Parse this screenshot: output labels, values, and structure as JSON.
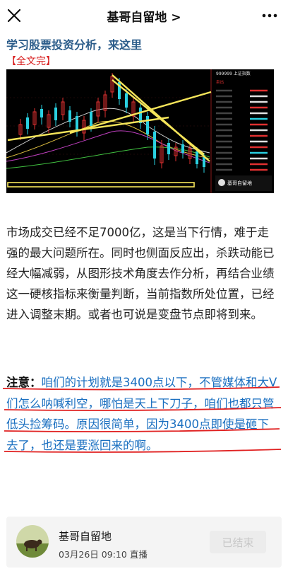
{
  "topbar": {
    "title": "基哥自留地",
    "title_chevron": ">",
    "close_icon": "close-icon",
    "more_icon": "more-icon"
  },
  "article": {
    "headline": "学习股票投资分析，来这里",
    "tag": "【全文完】",
    "paragraph": "市场成交已经不足7000亿，这是当下行情，难于走强的最大问题所在。同时也侧面反应出，杀跌动能已经大幅减弱，从图形技术角度去作分析，再结合业绩这一硬核指标来衡量判断，当前指数所处位置，已经进入调整末期。或者也可说是变盘节点即将到来。",
    "note_label": "注意：",
    "note_text": "咱们的计划就是3400点以下，不管媒体和大V们怎么呐喊利空，哪怕是天上下刀子，咱们也都只管低头捡筹码。原因很简单，因为3400点即使是砸下去了，也还是要涨回来的啊。"
  },
  "chart_image": {
    "panel_title": "999999 上证指数",
    "panel_label": "卖出",
    "watermark": "基哥自留地",
    "colors": {
      "background": "#000000",
      "up": "#e03030",
      "down": "#2ad0e0",
      "trendline": "#f5e55a"
    }
  },
  "live_card": {
    "author": "基哥自留地",
    "date": "03月26日",
    "time": "09:10",
    "status": "直播",
    "button": "已结束"
  },
  "colors": {
    "headline": "#2b5c8a",
    "tag": "#d92020",
    "note_text": "#1a6fc0",
    "underline": "#e02020"
  }
}
